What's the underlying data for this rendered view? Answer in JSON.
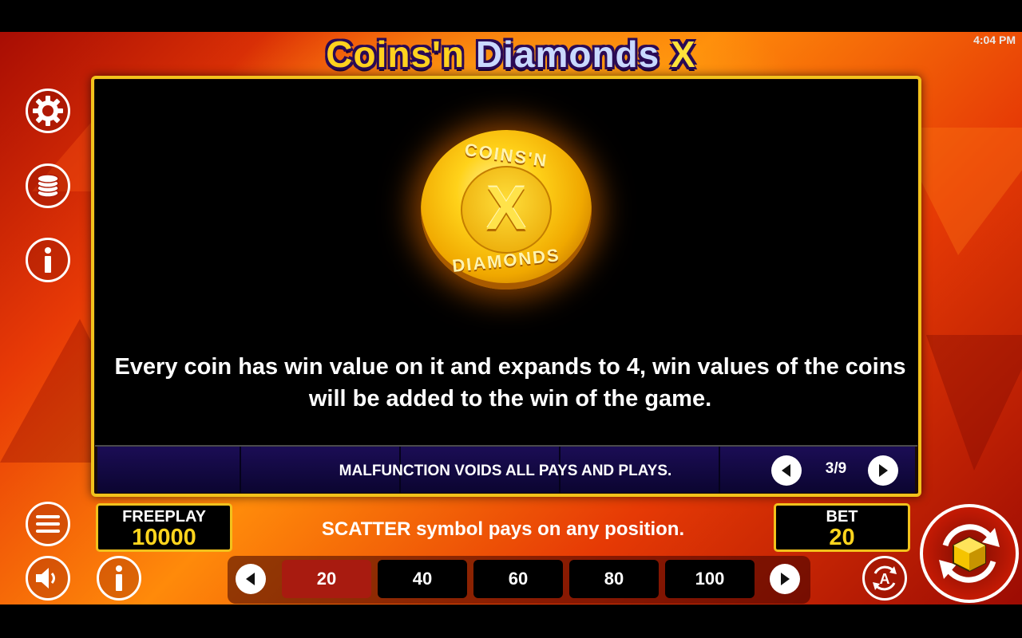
{
  "status_bar": {
    "time": "4:04 PM"
  },
  "game": {
    "title_part1": "Coins'n",
    "title_part2": "Diamonds",
    "title_part3": "X"
  },
  "info_panel": {
    "coin_text_top": "COINS'N",
    "coin_text_center": "X",
    "coin_text_bottom": "DIAMONDS",
    "description": "Every coin has win value on it and expands to 4, win values of the coins will be added to the win of the game.",
    "disclaimer": "MALFUNCTION VOIDS ALL PAYS AND PLAYS.",
    "page_indicator": "3/9"
  },
  "balance": {
    "label": "FREEPLAY",
    "value": "10000"
  },
  "bet": {
    "label": "BET",
    "value": "20"
  },
  "message": "SCATTER symbol pays on any position.",
  "bet_options": [
    "20",
    "40",
    "60",
    "80",
    "100"
  ],
  "selected_bet": "20",
  "icons": {
    "settings": "gear-icon",
    "coins": "coin-stack-icon",
    "info": "info-icon",
    "menu": "hamburger-menu-icon",
    "sound": "speaker-icon",
    "autoplay": "autoplay-icon",
    "spin": "spin-icon"
  },
  "colors": {
    "frame_gold": "#f2c21c",
    "value_yellow": "#ffd51e",
    "selected_bet": "#a81b10"
  }
}
